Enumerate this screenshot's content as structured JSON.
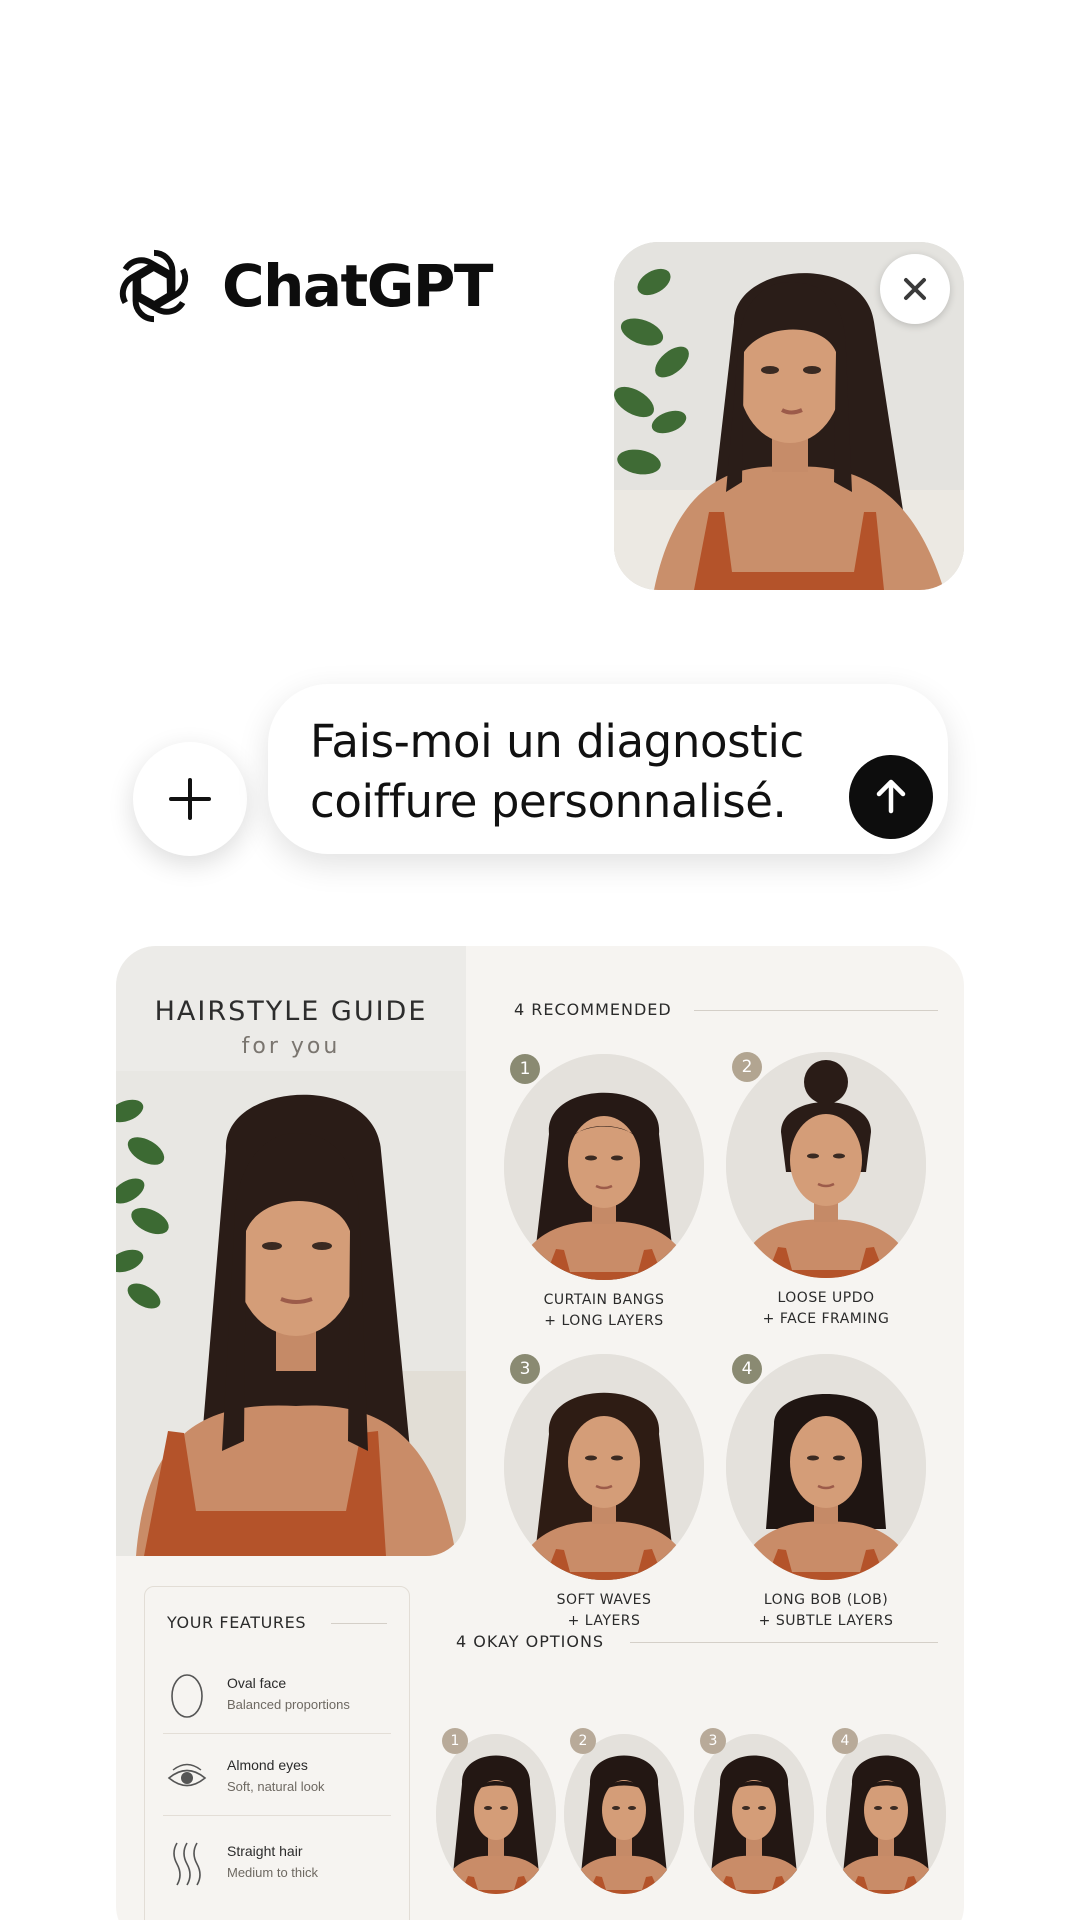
{
  "header": {
    "app_name": "ChatGPT"
  },
  "attachment": {
    "close_icon": "close-icon"
  },
  "composer": {
    "message": "Fais-moi un diagnostic coiffure personnalisé.",
    "plus_icon": "plus-icon",
    "send_icon": "arrow-up-icon"
  },
  "guide": {
    "title": "HAIRSTYLE GUIDE",
    "subtitle": "for you",
    "recommended_label": "4 RECOMMENDED",
    "recommended": [
      {
        "num": "1",
        "line1": "CURTAIN BANGS",
        "line2": "+ LONG LAYERS",
        "badge_color": "#8a8a72"
      },
      {
        "num": "2",
        "line1": "LOOSE UPDO",
        "line2": "+ FACE FRAMING",
        "badge_color": "#b2a591"
      },
      {
        "num": "3",
        "line1": "SOFT WAVES",
        "line2": "+ LAYERS",
        "badge_color": "#8a8a72"
      },
      {
        "num": "4",
        "line1": "LONG BOB (LOB)",
        "line2": "+ SUBTLE LAYERS",
        "badge_color": "#8a8a72"
      }
    ],
    "features_label": "YOUR FEATURES",
    "features": [
      {
        "name": "Oval face",
        "detail": "Balanced proportions",
        "icon": "oval-face-icon"
      },
      {
        "name": "Almond eyes",
        "detail": "Soft, natural look",
        "icon": "eye-icon"
      },
      {
        "name": "Straight hair",
        "detail": "Medium to thick",
        "icon": "hair-strands-icon"
      }
    ],
    "okay_label": "4 OKAY OPTIONS",
    "okay": [
      {
        "num": "1"
      },
      {
        "num": "2"
      },
      {
        "num": "3"
      },
      {
        "num": "4"
      }
    ]
  }
}
